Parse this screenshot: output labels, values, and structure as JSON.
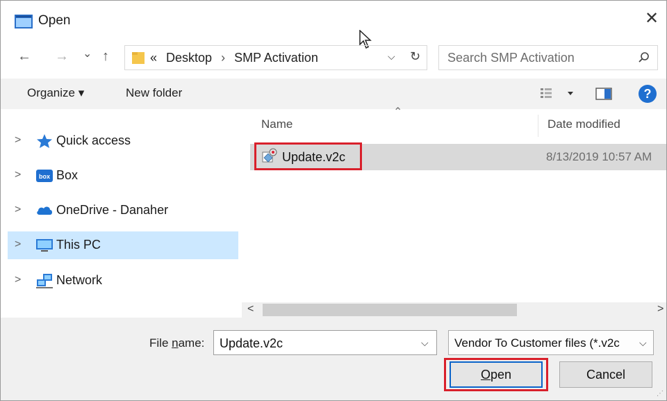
{
  "window": {
    "title": "Open",
    "close_glyph": "✕"
  },
  "nav": {
    "back": "←",
    "forward": "→",
    "recent": "⌄",
    "up": "↑",
    "breadcrumb_overflow": "«",
    "breadcrumb": [
      "Desktop",
      "SMP Activation"
    ],
    "breadcrumb_sep": "›",
    "search_placeholder": "Search SMP Activation"
  },
  "toolbar": {
    "organize": "Organize ▾",
    "new_folder": "New folder"
  },
  "nav_pane": {
    "items": [
      {
        "label": "Quick access",
        "icon": "star-icon"
      },
      {
        "label": "Box",
        "icon": "box-icon"
      },
      {
        "label": "OneDrive - Danaher",
        "icon": "cloud-icon"
      },
      {
        "label": "This PC",
        "icon": "monitor-icon",
        "selected": true
      },
      {
        "label": "Network",
        "icon": "network-icon"
      }
    ],
    "chevron": ">"
  },
  "file_list": {
    "columns": [
      "Name",
      "Date modified"
    ],
    "files": [
      {
        "name": "Update.v2c",
        "date_modified": "8/13/2019 10:57 AM"
      }
    ]
  },
  "scroll": {
    "left": "<",
    "right": ">"
  },
  "bottom": {
    "file_name_label_pre": "File ",
    "file_name_label_u": "n",
    "file_name_label_post": "ame:",
    "file_name_value": "Update.v2c",
    "filter": "Vendor To Customer files (*.v2c",
    "open_u": "O",
    "open_rest": "pen",
    "cancel": "Cancel"
  },
  "colors": {
    "accent": "#1f6fd0",
    "highlight": "#d9202b",
    "selected": "#cce8ff"
  }
}
